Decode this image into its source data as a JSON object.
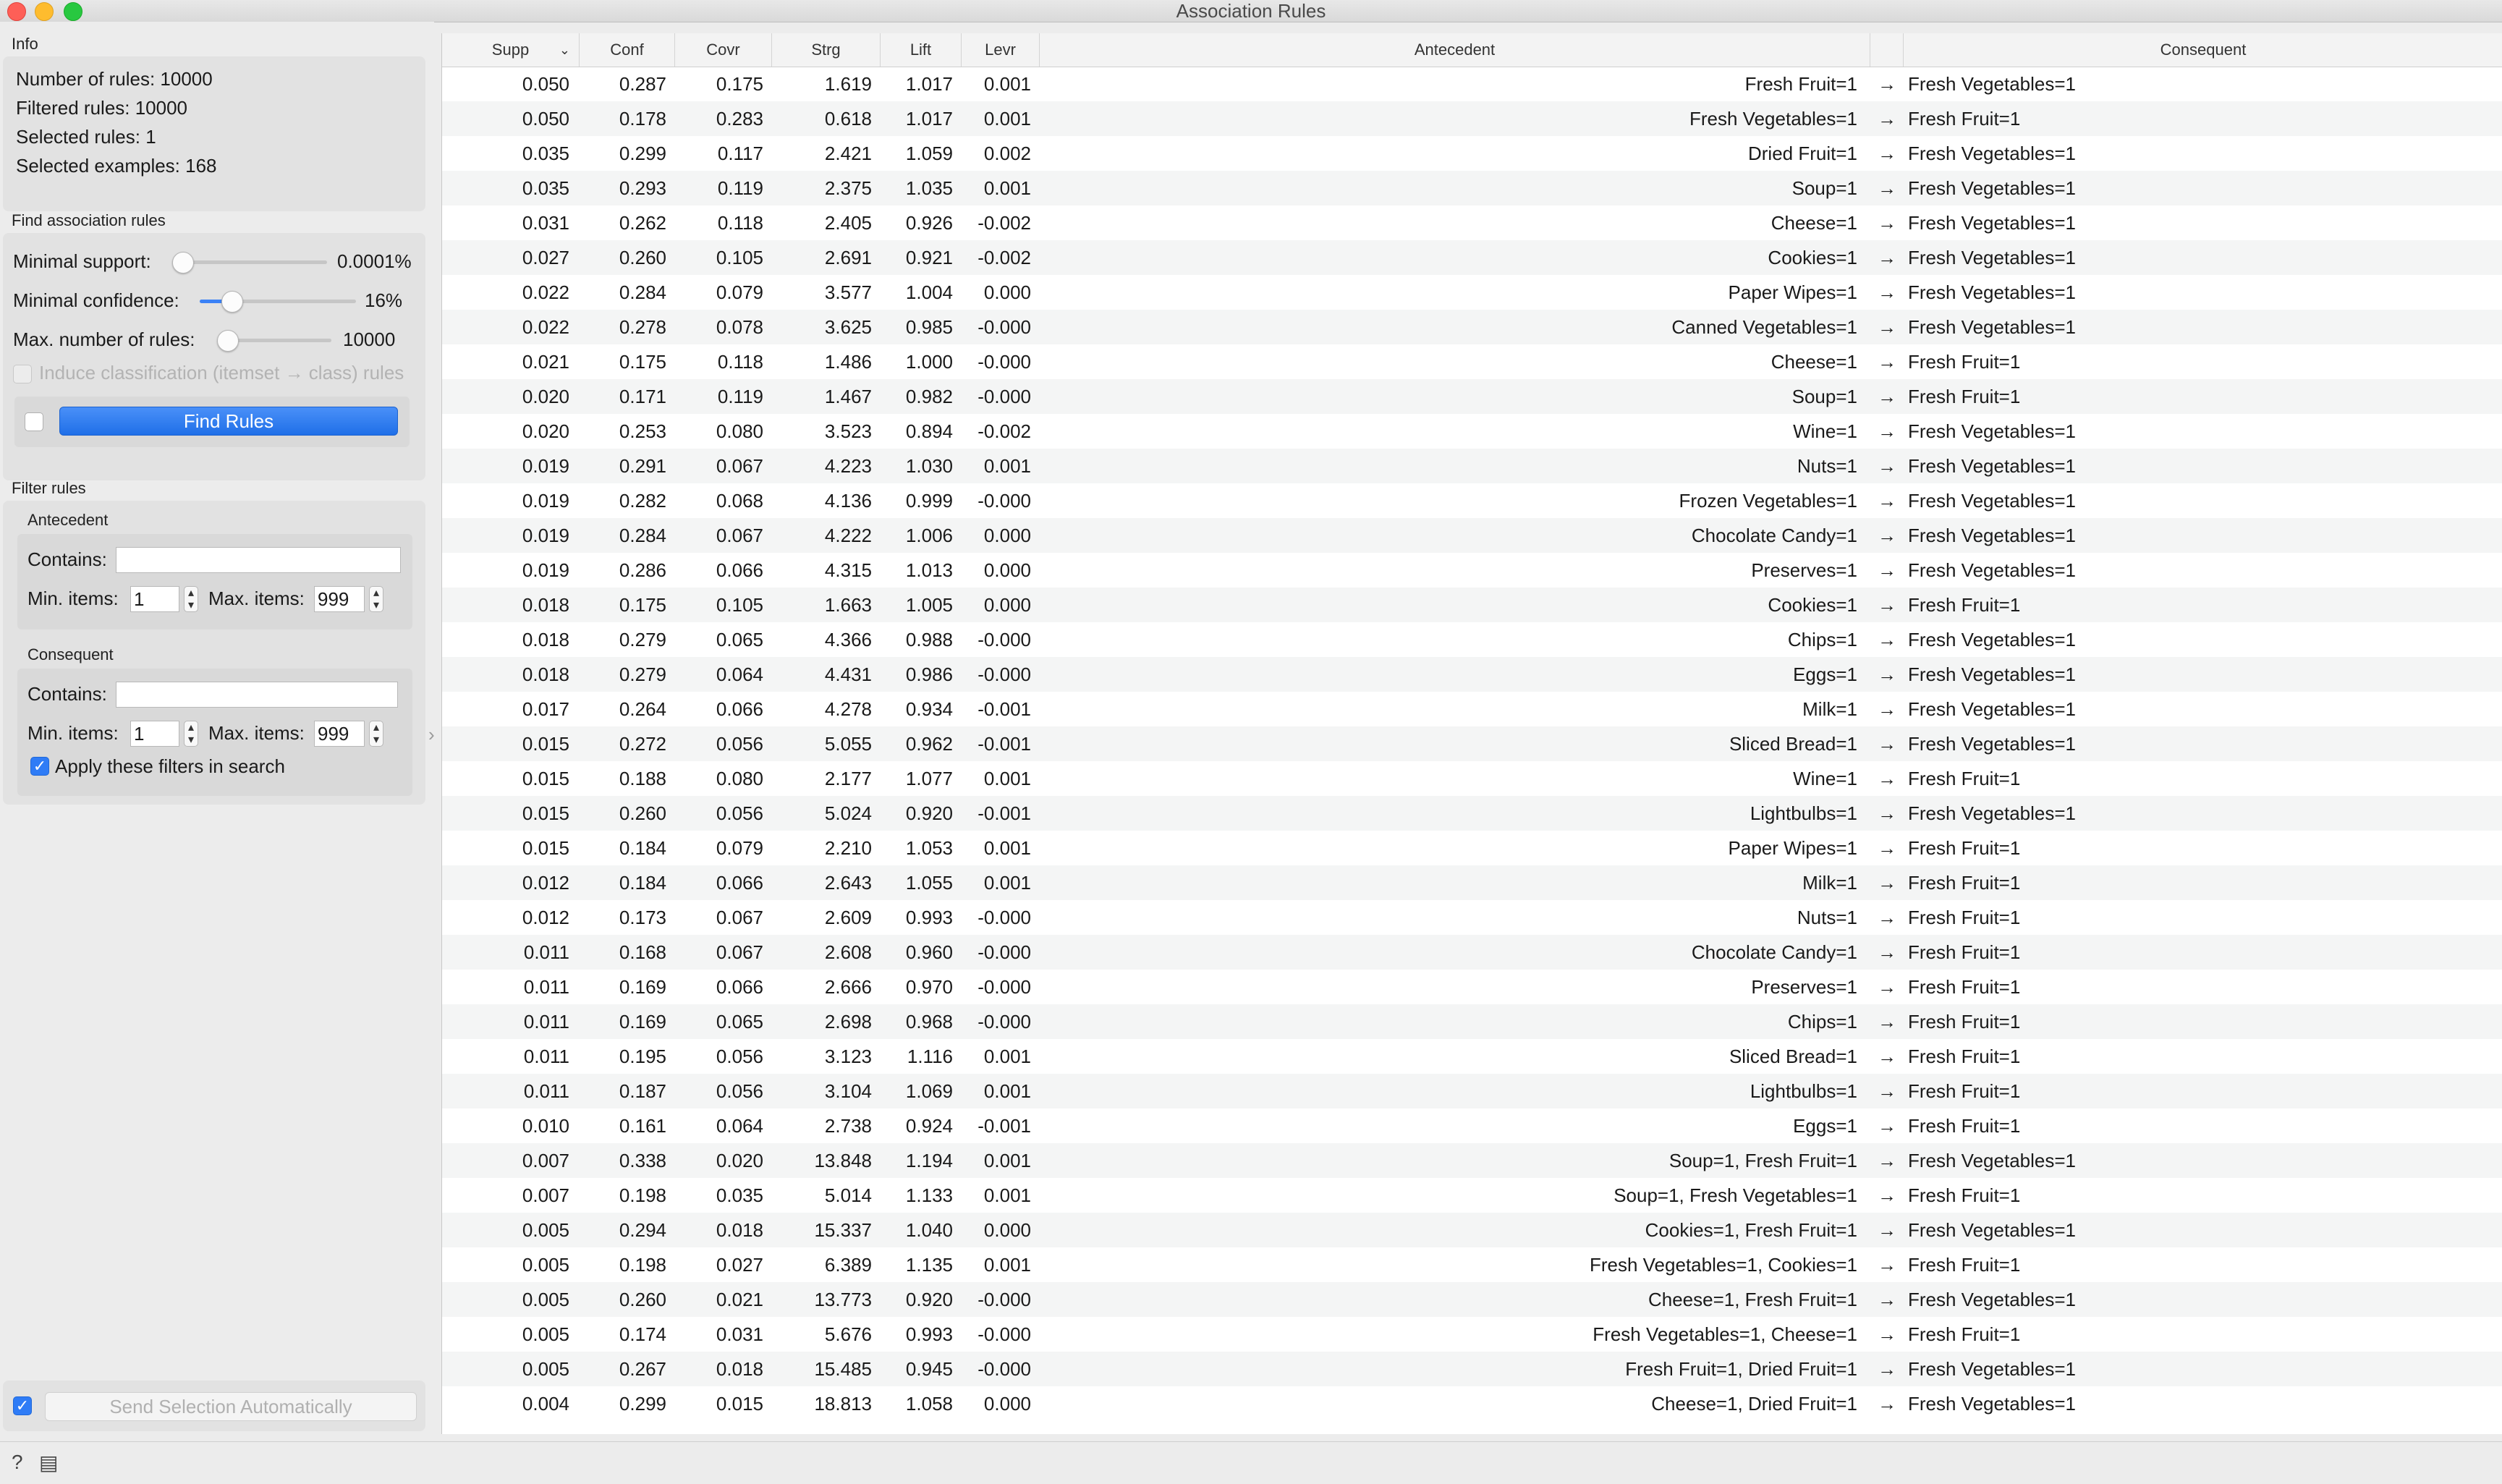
{
  "window": {
    "title": "Association Rules"
  },
  "info": {
    "section_title": "Info",
    "lines": [
      "Number of rules: 10000",
      "Filtered rules: 10000",
      "Selected rules: 1",
      "Selected examples: 168"
    ]
  },
  "find": {
    "section_title": "Find association rules",
    "min_support_label": "Minimal support:",
    "min_support_value": "0.0001%",
    "min_support_level": 0.0,
    "min_confidence_label": "Minimal confidence:",
    "min_confidence_value": "16%",
    "min_confidence_level": 0.16,
    "max_rules_label": "Max. number of rules:",
    "max_rules_value": "10000",
    "max_rules_level": 0.0,
    "induce_label": "Induce classification (itemset → class) rules",
    "button_label": "Find Rules"
  },
  "filter": {
    "section_title": "Filter rules",
    "antecedent": {
      "title": "Antecedent",
      "contains_label": "Contains:",
      "contains_value": "",
      "min_items_label": "Min. items:",
      "min_items_value": "1",
      "max_items_label": "Max. items:",
      "max_items_value": "999"
    },
    "consequent": {
      "title": "Consequent",
      "contains_label": "Contains:",
      "contains_value": "",
      "min_items_label": "Min. items:",
      "min_items_value": "1",
      "max_items_label": "Max. items:",
      "max_items_value": "999"
    },
    "apply_label": "Apply these filters in search",
    "apply_checked": true
  },
  "send": {
    "label": "Send Selection Automatically",
    "checked": true
  },
  "table": {
    "columns": [
      "Supp",
      "Conf",
      "Covr",
      "Strg",
      "Lift",
      "Levr",
      "Antecedent",
      "",
      "Consequent"
    ],
    "rows": [
      [
        "0.050",
        "0.287",
        "0.175",
        "1.619",
        "1.017",
        "0.001",
        "Fresh Fruit=1",
        "→",
        "Fresh Vegetables=1"
      ],
      [
        "0.050",
        "0.178",
        "0.283",
        "0.618",
        "1.017",
        "0.001",
        "Fresh Vegetables=1",
        "→",
        "Fresh Fruit=1"
      ],
      [
        "0.035",
        "0.299",
        "0.117",
        "2.421",
        "1.059",
        "0.002",
        "Dried Fruit=1",
        "→",
        "Fresh Vegetables=1"
      ],
      [
        "0.035",
        "0.293",
        "0.119",
        "2.375",
        "1.035",
        "0.001",
        "Soup=1",
        "→",
        "Fresh Vegetables=1"
      ],
      [
        "0.031",
        "0.262",
        "0.118",
        "2.405",
        "0.926",
        "-0.002",
        "Cheese=1",
        "→",
        "Fresh Vegetables=1"
      ],
      [
        "0.027",
        "0.260",
        "0.105",
        "2.691",
        "0.921",
        "-0.002",
        "Cookies=1",
        "→",
        "Fresh Vegetables=1"
      ],
      [
        "0.022",
        "0.284",
        "0.079",
        "3.577",
        "1.004",
        "0.000",
        "Paper Wipes=1",
        "→",
        "Fresh Vegetables=1"
      ],
      [
        "0.022",
        "0.278",
        "0.078",
        "3.625",
        "0.985",
        "-0.000",
        "Canned Vegetables=1",
        "→",
        "Fresh Vegetables=1"
      ],
      [
        "0.021",
        "0.175",
        "0.118",
        "1.486",
        "1.000",
        "-0.000",
        "Cheese=1",
        "→",
        "Fresh Fruit=1"
      ],
      [
        "0.020",
        "0.171",
        "0.119",
        "1.467",
        "0.982",
        "-0.000",
        "Soup=1",
        "→",
        "Fresh Fruit=1"
      ],
      [
        "0.020",
        "0.253",
        "0.080",
        "3.523",
        "0.894",
        "-0.002",
        "Wine=1",
        "→",
        "Fresh Vegetables=1"
      ],
      [
        "0.019",
        "0.291",
        "0.067",
        "4.223",
        "1.030",
        "0.001",
        "Nuts=1",
        "→",
        "Fresh Vegetables=1"
      ],
      [
        "0.019",
        "0.282",
        "0.068",
        "4.136",
        "0.999",
        "-0.000",
        "Frozen Vegetables=1",
        "→",
        "Fresh Vegetables=1"
      ],
      [
        "0.019",
        "0.284",
        "0.067",
        "4.222",
        "1.006",
        "0.000",
        "Chocolate Candy=1",
        "→",
        "Fresh Vegetables=1"
      ],
      [
        "0.019",
        "0.286",
        "0.066",
        "4.315",
        "1.013",
        "0.000",
        "Preserves=1",
        "→",
        "Fresh Vegetables=1"
      ],
      [
        "0.018",
        "0.175",
        "0.105",
        "1.663",
        "1.005",
        "0.000",
        "Cookies=1",
        "→",
        "Fresh Fruit=1"
      ],
      [
        "0.018",
        "0.279",
        "0.065",
        "4.366",
        "0.988",
        "-0.000",
        "Chips=1",
        "→",
        "Fresh Vegetables=1"
      ],
      [
        "0.018",
        "0.279",
        "0.064",
        "4.431",
        "0.986",
        "-0.000",
        "Eggs=1",
        "→",
        "Fresh Vegetables=1"
      ],
      [
        "0.017",
        "0.264",
        "0.066",
        "4.278",
        "0.934",
        "-0.001",
        "Milk=1",
        "→",
        "Fresh Vegetables=1"
      ],
      [
        "0.015",
        "0.272",
        "0.056",
        "5.055",
        "0.962",
        "-0.001",
        "Sliced Bread=1",
        "→",
        "Fresh Vegetables=1"
      ],
      [
        "0.015",
        "0.188",
        "0.080",
        "2.177",
        "1.077",
        "0.001",
        "Wine=1",
        "→",
        "Fresh Fruit=1"
      ],
      [
        "0.015",
        "0.260",
        "0.056",
        "5.024",
        "0.920",
        "-0.001",
        "Lightbulbs=1",
        "→",
        "Fresh Vegetables=1"
      ],
      [
        "0.015",
        "0.184",
        "0.079",
        "2.210",
        "1.053",
        "0.001",
        "Paper Wipes=1",
        "→",
        "Fresh Fruit=1"
      ],
      [
        "0.012",
        "0.184",
        "0.066",
        "2.643",
        "1.055",
        "0.001",
        "Milk=1",
        "→",
        "Fresh Fruit=1"
      ],
      [
        "0.012",
        "0.173",
        "0.067",
        "2.609",
        "0.993",
        "-0.000",
        "Nuts=1",
        "→",
        "Fresh Fruit=1"
      ],
      [
        "0.011",
        "0.168",
        "0.067",
        "2.608",
        "0.960",
        "-0.000",
        "Chocolate Candy=1",
        "→",
        "Fresh Fruit=1"
      ],
      [
        "0.011",
        "0.169",
        "0.066",
        "2.666",
        "0.970",
        "-0.000",
        "Preserves=1",
        "→",
        "Fresh Fruit=1"
      ],
      [
        "0.011",
        "0.169",
        "0.065",
        "2.698",
        "0.968",
        "-0.000",
        "Chips=1",
        "→",
        "Fresh Fruit=1"
      ],
      [
        "0.011",
        "0.195",
        "0.056",
        "3.123",
        "1.116",
        "0.001",
        "Sliced Bread=1",
        "→",
        "Fresh Fruit=1"
      ],
      [
        "0.011",
        "0.187",
        "0.056",
        "3.104",
        "1.069",
        "0.001",
        "Lightbulbs=1",
        "→",
        "Fresh Fruit=1"
      ],
      [
        "0.010",
        "0.161",
        "0.064",
        "2.738",
        "0.924",
        "-0.001",
        "Eggs=1",
        "→",
        "Fresh Fruit=1"
      ],
      [
        "0.007",
        "0.338",
        "0.020",
        "13.848",
        "1.194",
        "0.001",
        "Soup=1, Fresh Fruit=1",
        "→",
        "Fresh Vegetables=1"
      ],
      [
        "0.007",
        "0.198",
        "0.035",
        "5.014",
        "1.133",
        "0.001",
        "Soup=1, Fresh Vegetables=1",
        "→",
        "Fresh Fruit=1"
      ],
      [
        "0.005",
        "0.294",
        "0.018",
        "15.337",
        "1.040",
        "0.000",
        "Cookies=1, Fresh Fruit=1",
        "→",
        "Fresh Vegetables=1"
      ],
      [
        "0.005",
        "0.198",
        "0.027",
        "6.389",
        "1.135",
        "0.001",
        "Fresh Vegetables=1, Cookies=1",
        "→",
        "Fresh Fruit=1"
      ],
      [
        "0.005",
        "0.260",
        "0.021",
        "13.773",
        "0.920",
        "-0.000",
        "Cheese=1, Fresh Fruit=1",
        "→",
        "Fresh Vegetables=1"
      ],
      [
        "0.005",
        "0.174",
        "0.031",
        "5.676",
        "0.993",
        "-0.000",
        "Fresh Vegetables=1, Cheese=1",
        "→",
        "Fresh Fruit=1"
      ],
      [
        "0.005",
        "0.267",
        "0.018",
        "15.485",
        "0.945",
        "-0.000",
        "Fresh Fruit=1, Dried Fruit=1",
        "→",
        "Fresh Vegetables=1"
      ],
      [
        "0.004",
        "0.299",
        "0.015",
        "18.813",
        "1.058",
        "0.000",
        "Cheese=1, Dried Fruit=1",
        "→",
        "Fresh Vegetables=1"
      ]
    ]
  },
  "status": {
    "help_icon": "question-mark-icon",
    "report_icon": "document-icon"
  }
}
